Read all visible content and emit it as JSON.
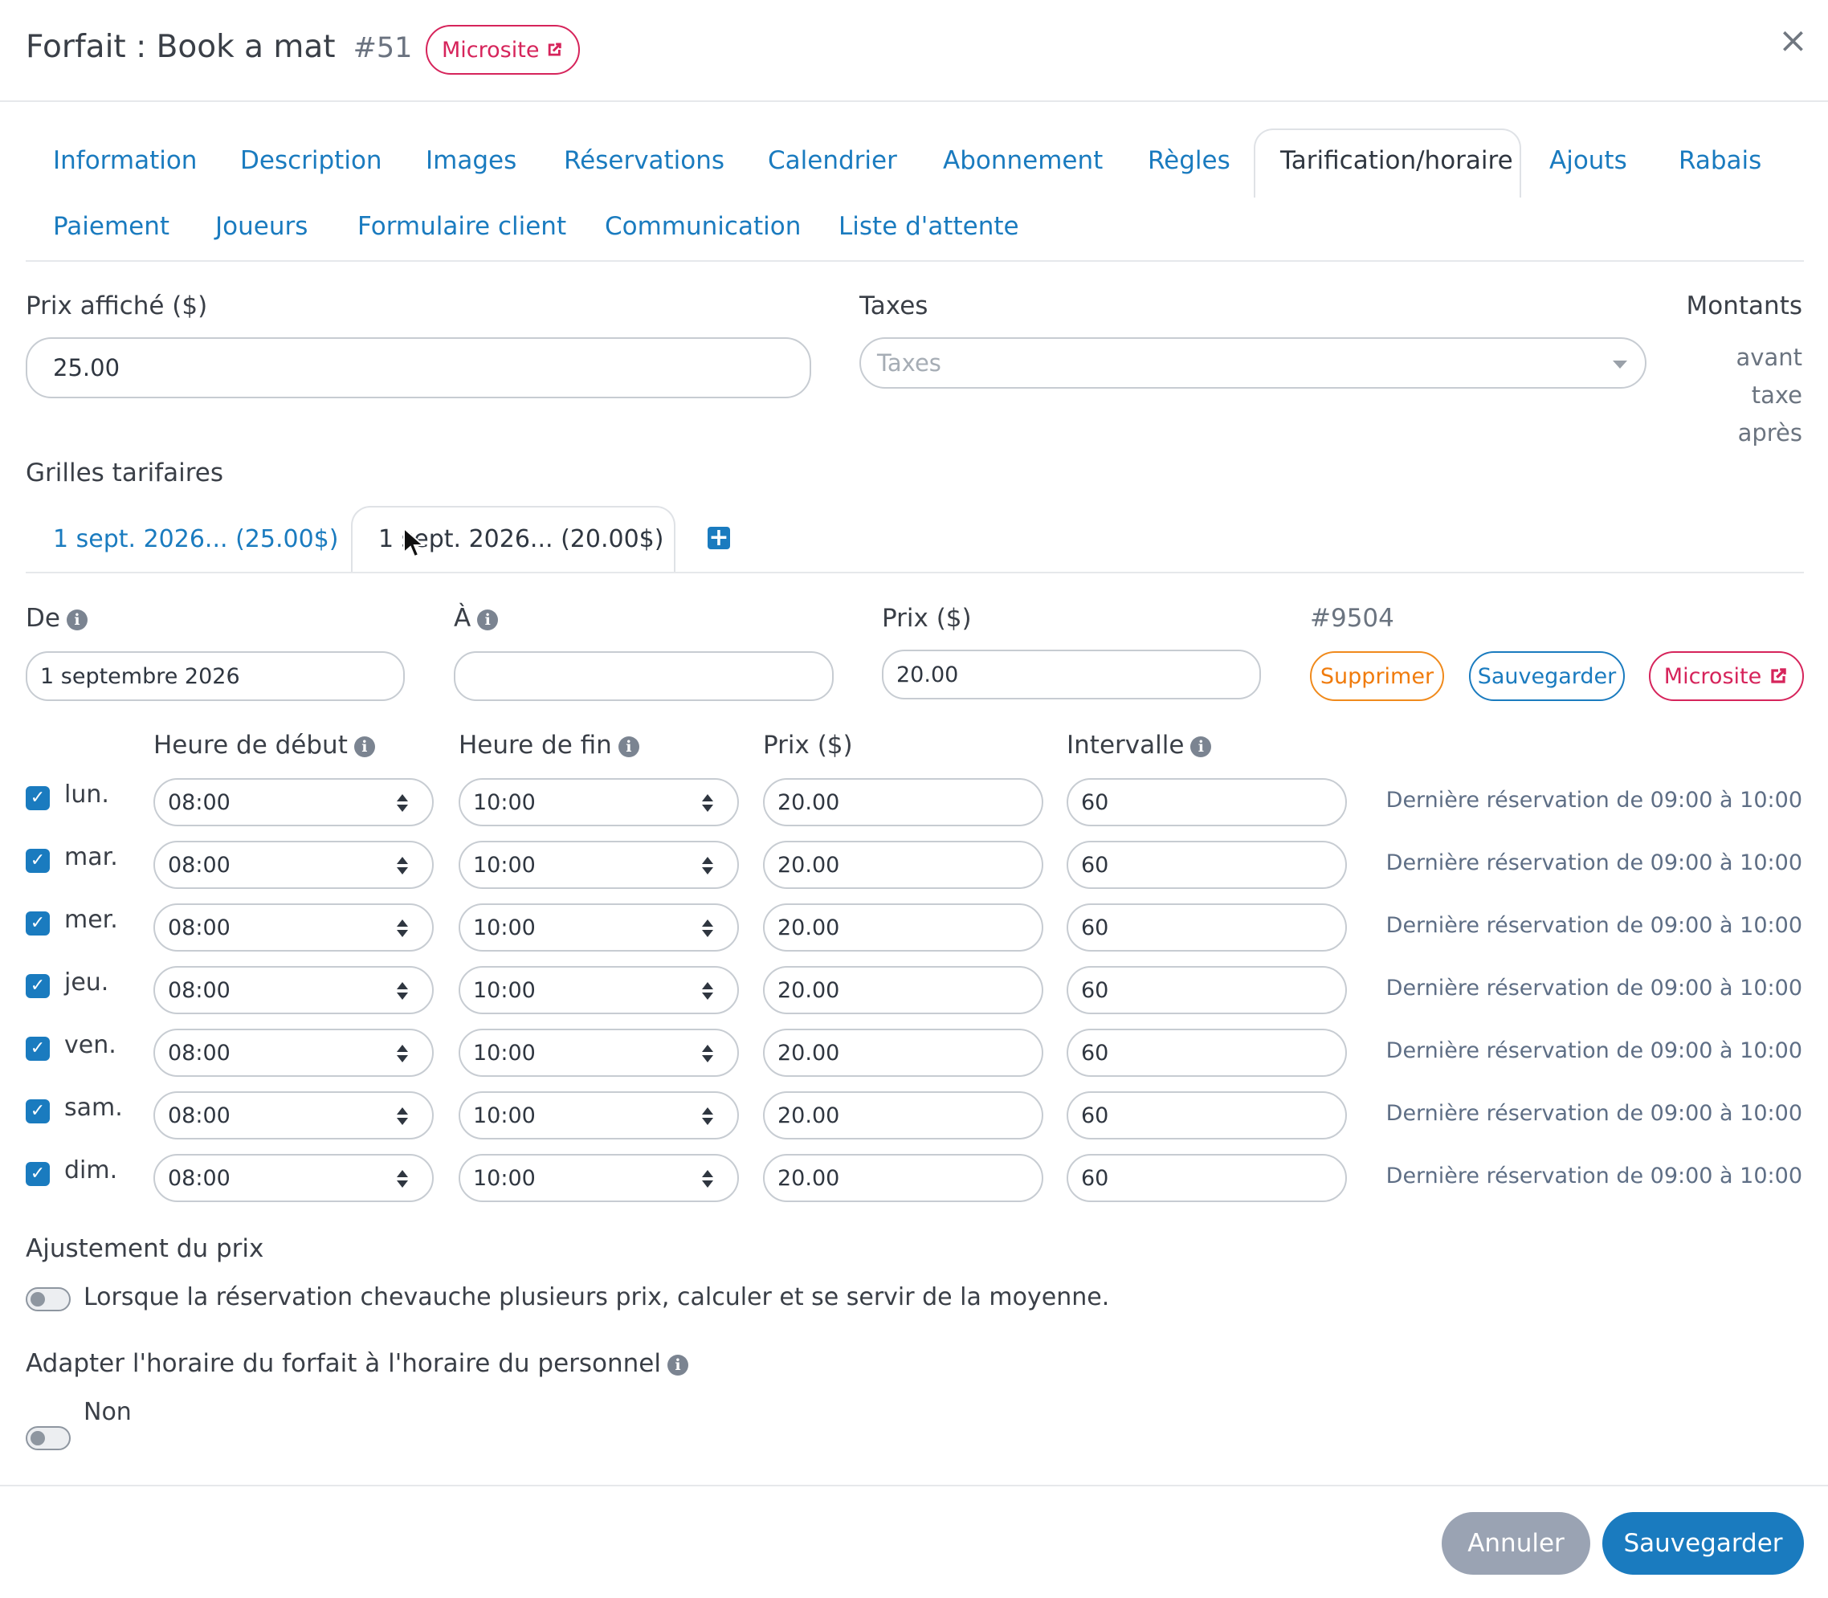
{
  "header": {
    "title": "Forfait : Book a mat",
    "id": "#51",
    "microsite_label": "Microsite",
    "close_label": "×"
  },
  "tabs": [
    {
      "label": "Information"
    },
    {
      "label": "Description"
    },
    {
      "label": "Images"
    },
    {
      "label": "Réservations"
    },
    {
      "label": "Calendrier"
    },
    {
      "label": "Abonnement"
    },
    {
      "label": "Règles"
    },
    {
      "label": "Tarification/horaire",
      "active": true
    },
    {
      "label": "Ajouts"
    },
    {
      "label": "Rabais"
    },
    {
      "label": "Paiement"
    },
    {
      "label": "Joueurs"
    },
    {
      "label": "Formulaire client"
    },
    {
      "label": "Communication"
    },
    {
      "label": "Liste d'attente"
    }
  ],
  "pricing": {
    "price_label": "Prix affiché ($)",
    "price_value": "25.00",
    "taxes_label": "Taxes",
    "taxes_placeholder": "Taxes",
    "amounts_label": "Montants",
    "amounts_options": [
      "avant",
      "taxe",
      "après"
    ]
  },
  "grids": {
    "label": "Grilles tarifaires",
    "tabs": [
      {
        "label": "1 sept. 2026... (25.00$)"
      },
      {
        "label": "1 sept. 2026... (20.00$)",
        "active": true
      }
    ],
    "add_icon": "plus-square-icon"
  },
  "grid_detail": {
    "from_label": "De",
    "from_value": "1 septembre 2026",
    "to_label": "À",
    "to_value": "",
    "price_label": "Prix ($)",
    "price_value": "20.00",
    "grid_id": "#9504",
    "delete_label": "Supprimer",
    "save_label": "Sauvegarder",
    "microsite_label": "Microsite"
  },
  "schedule": {
    "headers": {
      "start": "Heure de début",
      "end": "Heure de fin",
      "price": "Prix ($)",
      "interval": "Intervalle"
    },
    "rows": [
      {
        "day": "lun.",
        "checked": true,
        "start": "08:00",
        "end": "10:00",
        "price": "20.00",
        "interval": "60",
        "note": "Dernière réservation de 09:00 à 10:00"
      },
      {
        "day": "mar.",
        "checked": true,
        "start": "08:00",
        "end": "10:00",
        "price": "20.00",
        "interval": "60",
        "note": "Dernière réservation de 09:00 à 10:00"
      },
      {
        "day": "mer.",
        "checked": true,
        "start": "08:00",
        "end": "10:00",
        "price": "20.00",
        "interval": "60",
        "note": "Dernière réservation de 09:00 à 10:00"
      },
      {
        "day": "jeu.",
        "checked": true,
        "start": "08:00",
        "end": "10:00",
        "price": "20.00",
        "interval": "60",
        "note": "Dernière réservation de 09:00 à 10:00"
      },
      {
        "day": "ven.",
        "checked": true,
        "start": "08:00",
        "end": "10:00",
        "price": "20.00",
        "interval": "60",
        "note": "Dernière réservation de 09:00 à 10:00"
      },
      {
        "day": "sam.",
        "checked": true,
        "start": "08:00",
        "end": "10:00",
        "price": "20.00",
        "interval": "60",
        "note": "Dernière réservation de 09:00 à 10:00"
      },
      {
        "day": "dim.",
        "checked": true,
        "start": "08:00",
        "end": "10:00",
        "price": "20.00",
        "interval": "60",
        "note": "Dernière réservation de 09:00 à 10:00"
      }
    ]
  },
  "adjustment": {
    "label": "Ajustement du prix",
    "toggle_text": "Lorsque la réservation chevauche plusieurs prix, calculer et se servir de la moyenne.",
    "toggle_on": false
  },
  "staff_schedule": {
    "label": "Adapter l'horaire du forfait à l'horaire du personnel",
    "toggle_text": "Non",
    "toggle_on": false
  },
  "footer": {
    "cancel_label": "Annuler",
    "save_label": "Sauvegarder"
  },
  "colors": {
    "link_blue": "#1a7bbf",
    "microsite_pink": "#d6245b",
    "delete_orange": "#f07b0c",
    "cancel_grey": "#9aa3b3"
  }
}
